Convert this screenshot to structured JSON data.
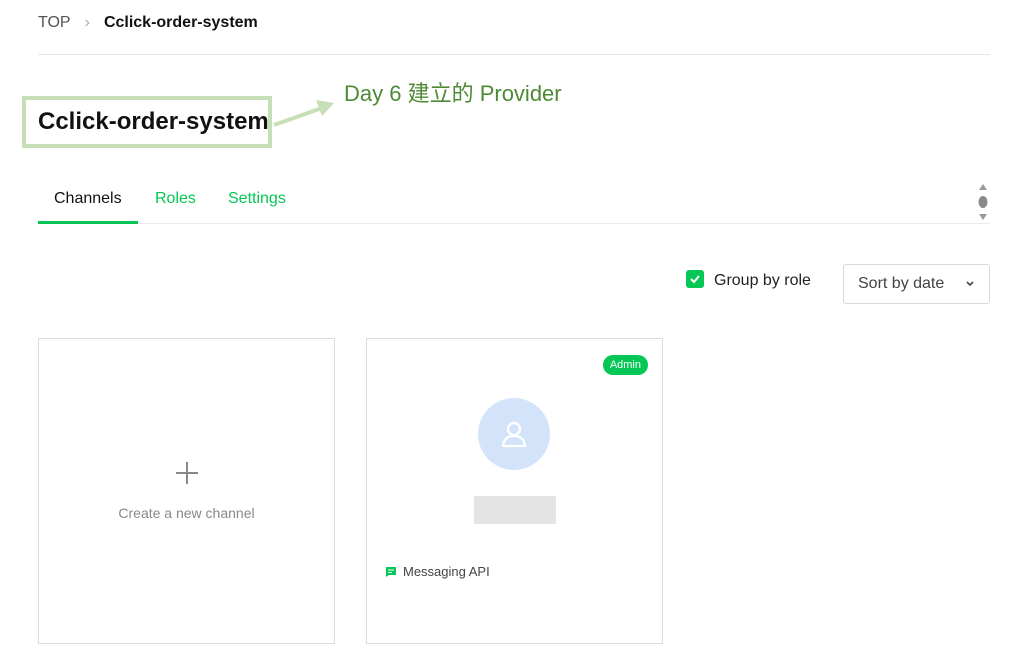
{
  "breadcrumb": {
    "root": "TOP",
    "separator": "›",
    "current": "Cclick-order-system"
  },
  "provider": {
    "name": "Cclick-order-system"
  },
  "annotation": {
    "text": "Day 6 建立的 Provider",
    "color": "#4e8a35",
    "box_color": "#c6dfb6"
  },
  "tabs": [
    {
      "label": "Channels",
      "active": true
    },
    {
      "label": "Roles",
      "active": false
    },
    {
      "label": "Settings",
      "active": false
    }
  ],
  "filters": {
    "group_by_role_label": "Group by role",
    "group_by_role_checked": true,
    "sort_label": "Sort by date"
  },
  "cards": {
    "create_label": "Create a new channel",
    "channel": {
      "badge": "Admin",
      "type": "Messaging API"
    }
  },
  "colors": {
    "accent": "#06c755",
    "avatar_bg": "#d3e3f9"
  },
  "icons": [
    "chevron-right-icon",
    "more-vertical-icon",
    "check-icon",
    "chevron-down-icon",
    "plus-icon",
    "user-icon",
    "chat-icon"
  ]
}
